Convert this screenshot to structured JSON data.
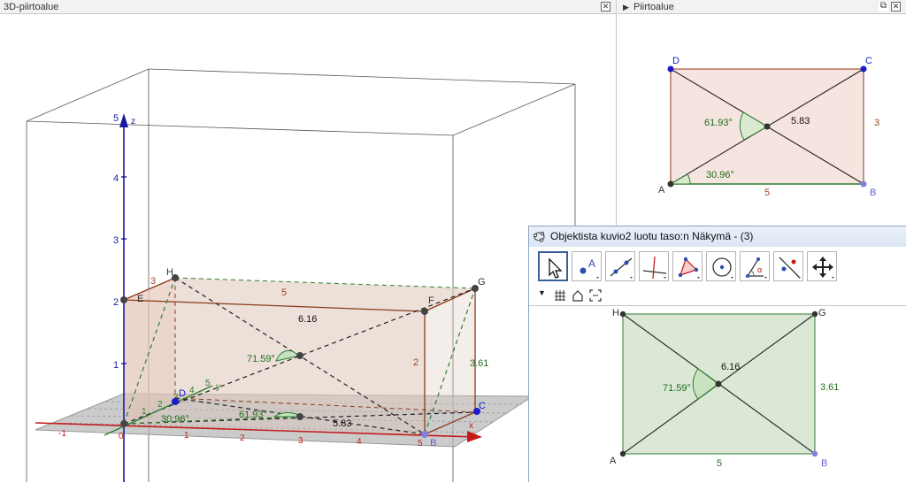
{
  "view3d": {
    "title": "3D-piirtoalue",
    "z_ticks": [
      "1",
      "2",
      "3",
      "4",
      "5"
    ],
    "z_axis_label": "z",
    "x_ticks": [
      "-1",
      "0",
      "1",
      "2",
      "3",
      "4",
      "5"
    ],
    "x_axis_label": "x",
    "y_ticks": [
      "1",
      "2",
      "3",
      "4",
      "5"
    ],
    "y_axis_label": "y",
    "points": {
      "H": "H",
      "E": "E",
      "F": "F",
      "G": "G",
      "D": "D",
      "C": "C",
      "B": "B",
      "A": "A"
    },
    "labels": {
      "len_5": "5",
      "len_3": "3",
      "len_2": "2",
      "diag_top": "6.16",
      "angle_top": "71.59°",
      "side_top": "3.61",
      "angle_bottom": "61.93°",
      "diag_bottom": "5.83",
      "angle_small": "30.96°"
    }
  },
  "view2d": {
    "title": "Piirtoalue",
    "points": {
      "A": "A",
      "B": "B",
      "C": "C",
      "D": "D"
    },
    "angle_center": "61.93°",
    "diag": "5.83",
    "side_right": "3",
    "angle_corner": "30.96°",
    "side_bottom": "5"
  },
  "plane_window": {
    "title": "Objektista kuvio2 luotu taso:n Näkymä - (3)",
    "tools": [
      "move-tool",
      "point-tool",
      "line-tool",
      "perpendicular-tool",
      "polygon-tool",
      "circle-tool",
      "angle-tool",
      "reflect-tool",
      "move-view-tool"
    ],
    "points": {
      "H": "H",
      "G": "G",
      "A": "A",
      "B": "B"
    },
    "diag": "6.16",
    "angle": "71.59°",
    "side_right": "3.61",
    "side_bottom": "5"
  }
}
